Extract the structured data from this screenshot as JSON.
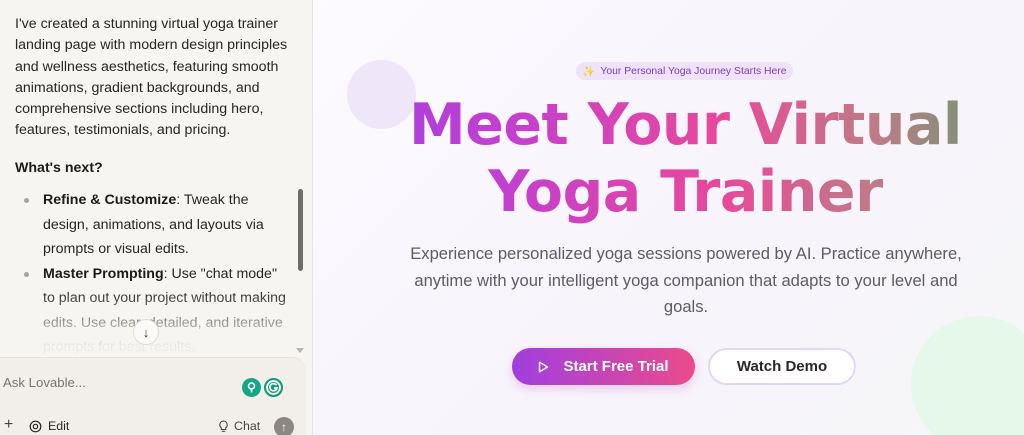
{
  "chat": {
    "intro_text": "I've created a stunning virtual yoga trainer landing page with modern design principles and wellness aesthetics, featuring smooth animations, gradient backgrounds, and comprehensive sections including hero, features, testimonials, and pricing.",
    "next_heading": "What's next?",
    "items": [
      {
        "title": "Refine & Customize",
        "text": ": Tweak the design, animations, and layouts via prompts or visual edits."
      },
      {
        "title": "Master Prompting",
        "text": ": Use \"chat mode\" to plan out your project without making edits. Use clear, detailed, and iterative prompts for best results."
      }
    ]
  },
  "composer": {
    "placeholder": "Ask Lovable...",
    "plus_icon": "+",
    "edit_label": "Edit",
    "chat_label": "Chat"
  },
  "preview": {
    "badge_icon": "✨",
    "badge_text": "Your Personal Yoga Journey Starts Here",
    "title_line1": "Meet Your Virtual",
    "title_line2": "Yoga Trainer",
    "subtitle": "Experience personalized yoga sessions powered by AI. Practice anywhere, anytime with your intelligent yoga companion that adapts to your level and goals.",
    "primary_cta": "Start Free Trial",
    "secondary_cta": "Watch Demo"
  },
  "colors": {
    "accent_purple": "#a13ee0",
    "accent_pink": "#ec4b8b",
    "accent_green": "#5aa06d",
    "badge_bg": "#efe3fb",
    "panel_bg": "#f7f5f1"
  }
}
